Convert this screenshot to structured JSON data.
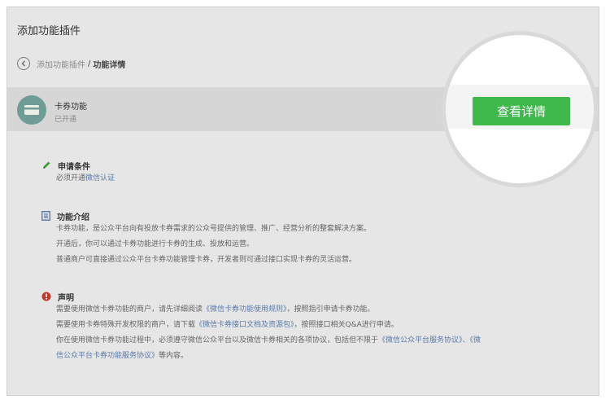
{
  "header": {
    "title": "添加功能插件"
  },
  "breadcrumb": {
    "parent": "添加功能插件",
    "separator": "/",
    "current": "功能详情"
  },
  "plugin": {
    "name": "卡券功能",
    "status": "已开通",
    "detail_button": "查看详情"
  },
  "sections": {
    "conditions": {
      "title": "申请条件",
      "line_prefix": "必须开通",
      "line_link": "微信认证",
      "icon": "pencil-icon"
    },
    "intro": {
      "title": "功能介绍",
      "icon": "document-icon",
      "lines": [
        "卡券功能，是公众平台向有投放卡券需求的公众号提供的管理、推广、经营分析的整套解决方案。",
        "开通后，你可以通过卡券功能进行卡券的生成、投放和运营。",
        "普通商户可直接通过公众平台卡券功能管理卡券，开发者则可通过接口实现卡券的灵活运营。"
      ]
    },
    "statement": {
      "title": "声明",
      "icon": "alert-icon",
      "l1_a": "需要使用微信卡券功能的商户，请先详细阅读",
      "l1_link": "《微信卡券功能使用规则》",
      "l1_b": "，按照指引申请卡券功能。",
      "l2_a": "需要使用卡券特殊开发权限的商户，请下载",
      "l2_link": "《微信卡券接口文档及资源包》",
      "l2_b": "，按照接口相关Q&A进行申请。",
      "l3_a": "你在使用微信卡券功能过程中，必须遵守微信公众平台以及微信卡券相关的各项协议，包括但不限于",
      "l3_link": "《微信公众平台服务协议》、《微",
      "l4_link": "信公众平台卡券功能服务协议》",
      "l4_b": "等内容。"
    }
  },
  "colors": {
    "accent_green": "#3fb84c",
    "link_blue": "#5a7aa8",
    "icon_teal": "#6f9c94",
    "alert_red": "#c0392b"
  }
}
